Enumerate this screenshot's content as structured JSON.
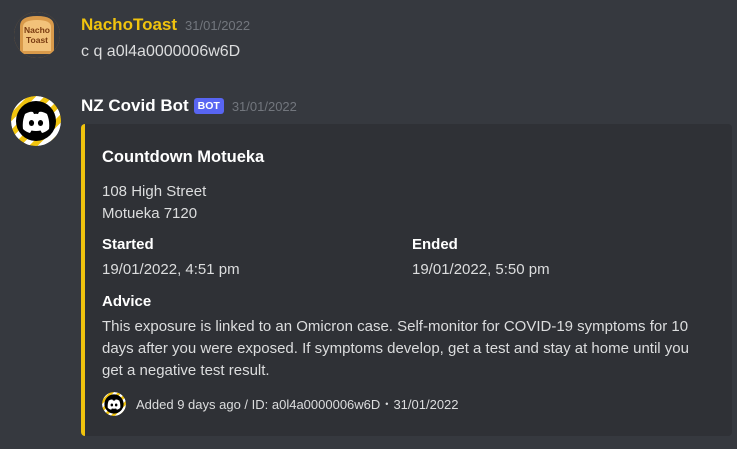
{
  "messages": [
    {
      "username": "NachoToast",
      "username_color": "#f0c30e",
      "timestamp": "31/01/2022",
      "avatar_text_line1": "Nacho",
      "avatar_text_line2": "Toast",
      "content": "c q a0l4a0000006w6D"
    },
    {
      "username": "NZ Covid Bot",
      "username_color": "#ffffff",
      "bot_tag": "BOT",
      "timestamp": "31/01/2022",
      "avatar_icon": "discord-logo-icon",
      "embed": {
        "accent_color": "#f0c30e",
        "title": "Countdown Motueka",
        "address_line1": "108 High Street",
        "address_line2": "Motueka 7120",
        "fields": {
          "started_name": "Started",
          "started_value": "19/01/2022, 4:51 pm",
          "ended_name": "Ended",
          "ended_value": "19/01/2022, 5:50 pm",
          "advice_name": "Advice",
          "advice_value": "This exposure is linked to an Omicron case. Self-monitor for COVID-19 symptoms for 10 days after you were exposed. If symptoms develop, get a test and stay at home until you get a negative test result."
        },
        "footer": {
          "text": "Added 9 days ago / ID: a0l4a0000006w6D",
          "separator": "•",
          "timestamp": "31/01/2022"
        }
      }
    }
  ]
}
